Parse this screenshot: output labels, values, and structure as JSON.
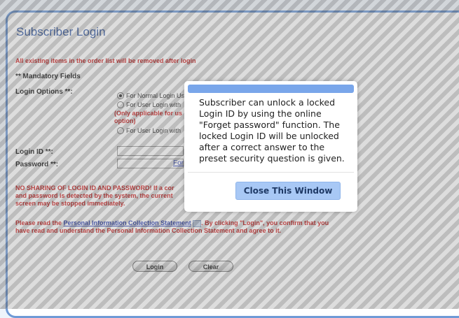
{
  "page": {
    "title": "Subscriber Login",
    "warning_top": "All existing items in the order list will be removed after login",
    "mandatory_note": "** Mandatory Fields",
    "login_options": {
      "label": "Login Options **:",
      "option_normal": "For Normal Login Us",
      "option_user_with_1": "For User Login with",
      "note_line1": "(Only applicable for us",
      "note_line2": "option)",
      "option_user_with_2": "For User Login with"
    },
    "login_id_label": "Login ID **:",
    "password_label": "Password **:",
    "forget_link": "For",
    "no_sharing_line1": "NO SHARING OF LOGIN ID AND PASSWORD! If a cor",
    "no_sharing_line2": "and password is detected by the system, the current",
    "no_sharing_line3": "screen may be stopped immediately.",
    "pics_prefix": "Please read the ",
    "pics_link": "Personal Information Collection Statement",
    "pics_suffix_line1": ". By clicking \"Login\", you confirm that you",
    "pics_line2": "have read and understand the Personal Information Collection Statement and agree to it.",
    "login_button": "Login",
    "clear_button": "Clear"
  },
  "modal": {
    "message": "Subscriber can unlock a locked Login ID by using the online \"Forget password\" function. The locked Login ID will be unlocked after a correct answer to the preset security question is given.",
    "close_button": "Close This Window"
  },
  "icons": {
    "radio": "radio-button-icon",
    "document": "document-icon"
  },
  "colors": {
    "title": "#3a5fa8",
    "warning": "#cc2222",
    "link": "#2a3fb0",
    "modal_bar": "#79a6ea",
    "modal_button": "#a8c8f5"
  }
}
